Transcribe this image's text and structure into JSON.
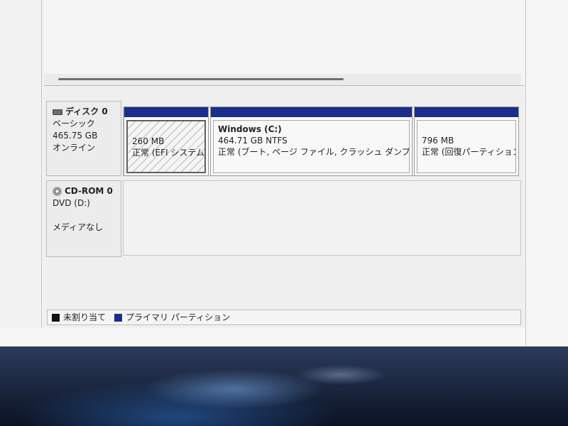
{
  "disks": [
    {
      "name": "ディスク 0",
      "type": "ベーシック",
      "size": "465.75 GB",
      "status": "オンライン",
      "partitions": [
        {
          "title": "",
          "size": "260 MB",
          "status": "正常 (EFI システム パ"
        },
        {
          "title": "Windows  (C:)",
          "size": "464.71 GB NTFS",
          "status": "正常 (ブート, ページ ファイル, クラッシュ ダンプ, ベーシ"
        },
        {
          "title": "",
          "size": "796 MB",
          "status": "正常 (回復パーティション"
        }
      ]
    },
    {
      "name": "CD-ROM 0",
      "type": "DVD (D:)",
      "size": "",
      "status": "メディアなし"
    }
  ],
  "legend": [
    {
      "label": "未割り当て",
      "color": "#111111"
    },
    {
      "label": "プライマリ パーティション",
      "color": "#1c2e8c"
    }
  ]
}
